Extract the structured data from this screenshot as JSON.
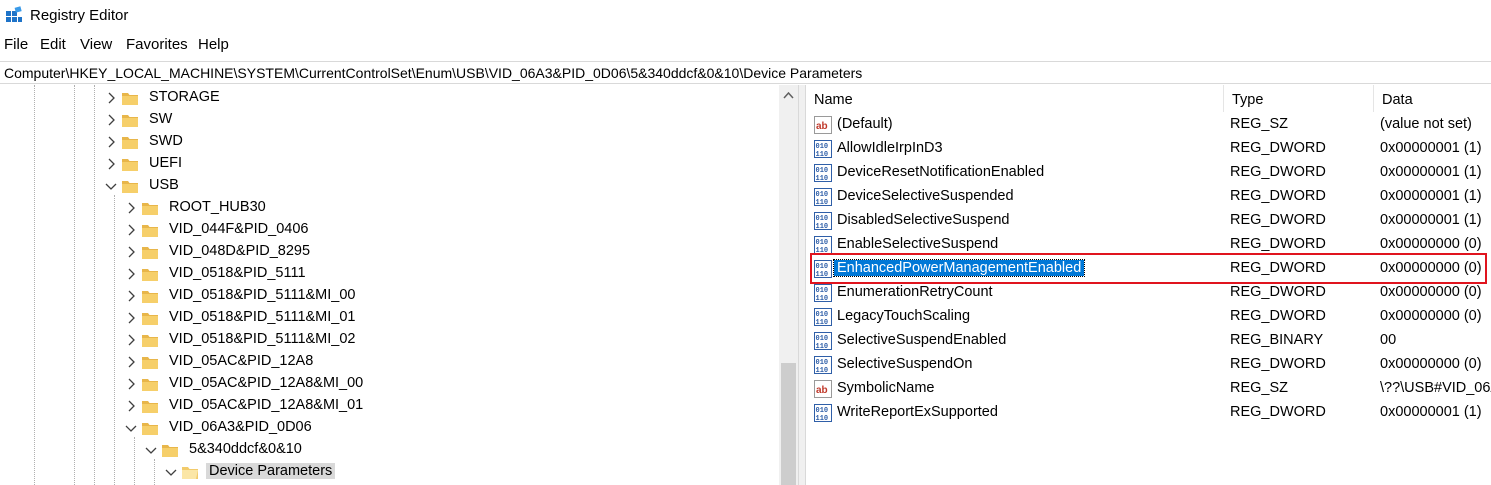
{
  "window": {
    "title": "Registry Editor",
    "app_icon": "regedit-icon"
  },
  "menu": [
    "File",
    "Edit",
    "View",
    "Favorites",
    "Help"
  ],
  "address": "Computer\\HKEY_LOCAL_MACHINE\\SYSTEM\\CurrentControlSet\\Enum\\USB\\VID_06A3&PID_0D06\\5&340ddcf&0&10\\Device Parameters",
  "tree": [
    {
      "label": "STORAGE",
      "level": 0,
      "expanded": false
    },
    {
      "label": "SW",
      "level": 0,
      "expanded": false
    },
    {
      "label": "SWD",
      "level": 0,
      "expanded": false
    },
    {
      "label": "UEFI",
      "level": 0,
      "expanded": false
    },
    {
      "label": "USB",
      "level": 0,
      "expanded": true
    },
    {
      "label": "ROOT_HUB30",
      "level": 1,
      "expanded": false
    },
    {
      "label": "VID_044F&PID_0406",
      "level": 1,
      "expanded": false
    },
    {
      "label": "VID_048D&PID_8295",
      "level": 1,
      "expanded": false
    },
    {
      "label": "VID_0518&PID_5111",
      "level": 1,
      "expanded": false
    },
    {
      "label": "VID_0518&PID_5111&MI_00",
      "level": 1,
      "expanded": false
    },
    {
      "label": "VID_0518&PID_5111&MI_01",
      "level": 1,
      "expanded": false
    },
    {
      "label": "VID_0518&PID_5111&MI_02",
      "level": 1,
      "expanded": false
    },
    {
      "label": "VID_05AC&PID_12A8",
      "level": 1,
      "expanded": false
    },
    {
      "label": "VID_05AC&PID_12A8&MI_00",
      "level": 1,
      "expanded": false
    },
    {
      "label": "VID_05AC&PID_12A8&MI_01",
      "level": 1,
      "expanded": false
    },
    {
      "label": "VID_06A3&PID_0D06",
      "level": 1,
      "expanded": true
    },
    {
      "label": "5&340ddcf&0&10",
      "level": 2,
      "expanded": true
    },
    {
      "label": "Device Parameters",
      "level": 3,
      "expanded": true,
      "selected": true
    }
  ],
  "columns": {
    "name": "Name",
    "type": "Type",
    "data": "Data"
  },
  "values": [
    {
      "name": "(Default)",
      "type": "REG_SZ",
      "data": "(value not set)",
      "icon": "string-value-icon"
    },
    {
      "name": "AllowIdleIrpInD3",
      "type": "REG_DWORD",
      "data": "0x00000001 (1)",
      "icon": "binary-value-icon"
    },
    {
      "name": "DeviceResetNotificationEnabled",
      "type": "REG_DWORD",
      "data": "0x00000001 (1)",
      "icon": "binary-value-icon"
    },
    {
      "name": "DeviceSelectiveSuspended",
      "type": "REG_DWORD",
      "data": "0x00000001 (1)",
      "icon": "binary-value-icon"
    },
    {
      "name": "DisabledSelectiveSuspend",
      "type": "REG_DWORD",
      "data": "0x00000001 (1)",
      "icon": "binary-value-icon"
    },
    {
      "name": "EnableSelectiveSuspend",
      "type": "REG_DWORD",
      "data": "0x00000000 (0)",
      "icon": "binary-value-icon"
    },
    {
      "name": "EnhancedPowerManagementEnabled",
      "type": "REG_DWORD",
      "data": "0x00000000 (0)",
      "icon": "binary-value-icon",
      "selected": true
    },
    {
      "name": "EnumerationRetryCount",
      "type": "REG_DWORD",
      "data": "0x00000000 (0)",
      "icon": "binary-value-icon"
    },
    {
      "name": "LegacyTouchScaling",
      "type": "REG_DWORD",
      "data": "0x00000000 (0)",
      "icon": "binary-value-icon"
    },
    {
      "name": "SelectiveSuspendEnabled",
      "type": "REG_BINARY",
      "data": "00",
      "icon": "binary-value-icon"
    },
    {
      "name": "SelectiveSuspendOn",
      "type": "REG_DWORD",
      "data": "0x00000000 (0)",
      "icon": "binary-value-icon"
    },
    {
      "name": "SymbolicName",
      "type": "REG_SZ",
      "data": "\\??\\USB#VID_06A",
      "icon": "string-value-icon"
    },
    {
      "name": "WriteReportExSupported",
      "type": "REG_DWORD",
      "data": "0x00000001 (1)",
      "icon": "binary-value-icon"
    }
  ],
  "colors": {
    "selection": "#0078d7",
    "highlight_box": "#e0141e",
    "folder": "#e8b64a"
  }
}
